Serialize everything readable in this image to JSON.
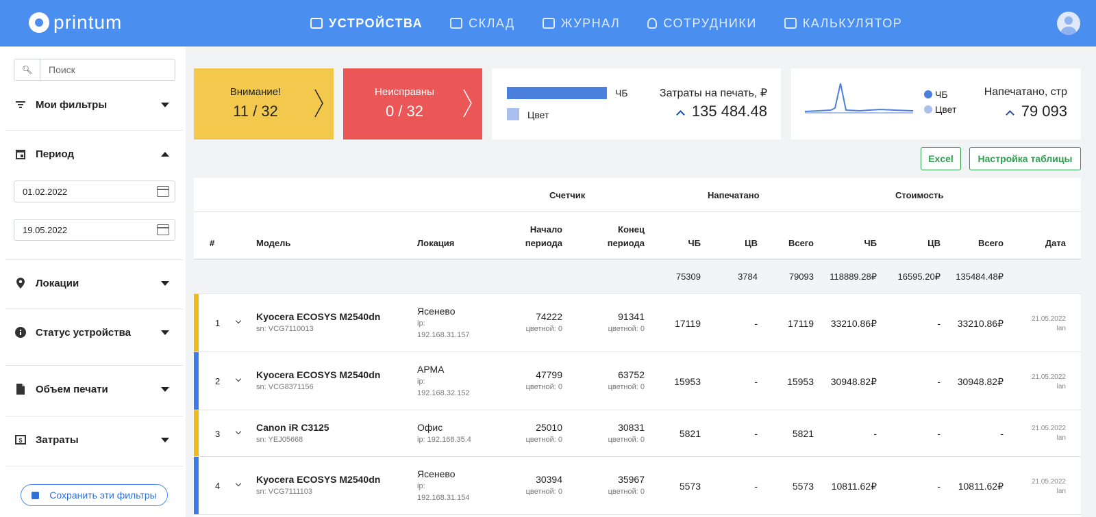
{
  "app": {
    "logo_text": "printum"
  },
  "nav": [
    {
      "label": "УСТРОЙСТВА",
      "icon": "printer-icon",
      "active": true
    },
    {
      "label": "СКЛАД",
      "icon": "warehouse-icon",
      "active": false
    },
    {
      "label": "ЖУРНАЛ",
      "icon": "book-icon",
      "active": false
    },
    {
      "label": "СОТРУДНИКИ",
      "icon": "user-icon",
      "active": false
    },
    {
      "label": "КАЛЬКУЛЯТОР",
      "icon": "calculator-icon",
      "active": false
    }
  ],
  "sidebar": {
    "search_placeholder": "Поиск",
    "my_filters": "Мои фильтры",
    "period": "Период",
    "date_from": "01.02.2022",
    "date_to": "19.05.2022",
    "locations": "Локации",
    "device_status": "Статус устройства",
    "print_volume": "Объем печати",
    "costs": "Затраты",
    "save_filters": "Сохранить эти фильтры"
  },
  "cards": {
    "warning": {
      "title": "Внимание!",
      "value": "11 / 32",
      "color": "#f2c94c"
    },
    "broken": {
      "title": "Неисправны",
      "value": "0 / 32",
      "color": "#eb5757"
    },
    "cost": {
      "legend_bw": "ЧБ",
      "legend_color": "Цвет",
      "title": "Затраты на печать, ₽",
      "value": "135 484.48",
      "bar_bw_fraction": 1.0
    },
    "printed": {
      "legend_bw": "ЧБ",
      "legend_color": "Цвет",
      "title": "Напечатано, стр",
      "value": "79 093"
    }
  },
  "buttons": {
    "excel": "Excel",
    "table_settings": "Настройка таблицы"
  },
  "table": {
    "groups": {
      "counter": "Счетчик",
      "printed": "Напечатано",
      "cost": "Стоимость"
    },
    "headers": {
      "num": "#",
      "model": "Модель",
      "location": "Локация",
      "start_1": "Начало",
      "start_2": "периода",
      "end_1": "Конец",
      "end_2": "периода",
      "bw": "ЧБ",
      "color": "ЦВ",
      "total": "Всего",
      "cost_bw": "ЧБ",
      "cost_color": "ЦВ",
      "cost_total": "Всего",
      "date": "Дата"
    },
    "totals": {
      "bw": "75309",
      "color": "3784",
      "total": "79093",
      "cost_bw": "118889.28₽",
      "cost_color": "16595.20₽",
      "cost_total": "135484.48₽"
    },
    "rows": [
      {
        "num": "1",
        "model": "Kyocera ECOSYS M2540dn",
        "sn": "sn: VCG7110013",
        "location": "Ясенево",
        "ip1": "ip:",
        "ip2": "192.168.31.157",
        "start": "74222",
        "start_color": "цветной: 0",
        "end": "91341",
        "end_color": "цветной: 0",
        "bw": "17119",
        "color": "-",
        "total": "17119",
        "cost_bw": "33210.86₽",
        "cost_color": "-",
        "cost_total": "33210.86₽",
        "date": "21.05.2022",
        "source": "lan",
        "stripe": "#f2b81a"
      },
      {
        "num": "2",
        "model": "Kyocera ECOSYS M2540dn",
        "sn": "sn: VCG8371156",
        "location": "АРМА",
        "ip1": "ip:",
        "ip2": "192.168.32.152",
        "start": "47799",
        "start_color": "цветной: 0",
        "end": "63752",
        "end_color": "цветной: 0",
        "bw": "15953",
        "color": "-",
        "total": "15953",
        "cost_bw": "30948.82₽",
        "cost_color": "-",
        "cost_total": "30948.82₽",
        "date": "21.05.2022",
        "source": "lan",
        "stripe": "#3a7ce8"
      },
      {
        "num": "3",
        "model": "Canon iR C3125",
        "sn": "sn: YEJ05668",
        "location": "Офис",
        "ip1": "ip: 192.168.35.4",
        "ip2": "",
        "start": "25010",
        "start_color": "цветной: 0",
        "end": "30831",
        "end_color": "цветной: 0",
        "bw": "5821",
        "color": "-",
        "total": "5821",
        "cost_bw": "-",
        "cost_color": "-",
        "cost_total": "-",
        "date": "21.05.2022",
        "source": "lan",
        "stripe": "#f2b81a"
      },
      {
        "num": "4",
        "model": "Kyocera ECOSYS M2540dn",
        "sn": "sn: VCG7111103",
        "location": "Ясенево",
        "ip1": "ip:",
        "ip2": "192.168.31.154",
        "start": "30394",
        "start_color": "цветной: 0",
        "end": "35967",
        "end_color": "цветной: 0",
        "bw": "5573",
        "color": "-",
        "total": "5573",
        "cost_bw": "10811.62₽",
        "cost_color": "-",
        "cost_total": "10811.62₽",
        "date": "21.05.2022",
        "source": "lan",
        "stripe": "#3a7ce8"
      }
    ]
  }
}
